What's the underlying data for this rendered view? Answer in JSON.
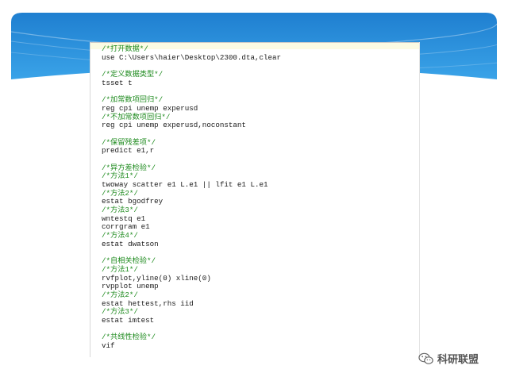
{
  "code_lines": [
    {
      "kind": "comment",
      "text": "/*打开数据*/"
    },
    {
      "kind": "code",
      "text": "use C:\\Users\\haier\\Desktop\\2300.dta,clear"
    },
    {
      "kind": "blank",
      "text": ""
    },
    {
      "kind": "comment",
      "text": "/*定义数据类型*/"
    },
    {
      "kind": "code",
      "text": "tsset t"
    },
    {
      "kind": "blank",
      "text": ""
    },
    {
      "kind": "comment",
      "text": "/*加常数项回归*/"
    },
    {
      "kind": "code",
      "text": "reg cpi unemp experusd"
    },
    {
      "kind": "comment",
      "text": "/*不加常数项回归*/"
    },
    {
      "kind": "code",
      "text": "reg cpi unemp experusd,noconstant"
    },
    {
      "kind": "blank",
      "text": ""
    },
    {
      "kind": "comment",
      "text": "/*保留残差项*/"
    },
    {
      "kind": "code",
      "text": "predict e1,r"
    },
    {
      "kind": "blank",
      "text": ""
    },
    {
      "kind": "comment",
      "text": "/*异方差检验*/"
    },
    {
      "kind": "comment",
      "text": "/*方法1*/"
    },
    {
      "kind": "code",
      "text": "twoway scatter e1 L.e1 || lfit e1 L.e1"
    },
    {
      "kind": "comment",
      "text": "/*方法2*/"
    },
    {
      "kind": "code",
      "text": "estat bgodfrey"
    },
    {
      "kind": "comment",
      "text": "/*方法3*/"
    },
    {
      "kind": "code",
      "text": "wntestq e1"
    },
    {
      "kind": "code",
      "text": "corrgram e1"
    },
    {
      "kind": "comment",
      "text": "/*方法4*/"
    },
    {
      "kind": "code",
      "text": "estat dwatson"
    },
    {
      "kind": "blank",
      "text": ""
    },
    {
      "kind": "comment",
      "text": "/*自相关检验*/"
    },
    {
      "kind": "comment",
      "text": "/*方法1*/"
    },
    {
      "kind": "code",
      "text": "rvfplot,yline(0) xline(0)"
    },
    {
      "kind": "code",
      "text": "rvpplot unemp"
    },
    {
      "kind": "comment",
      "text": "/*方法2*/"
    },
    {
      "kind": "code",
      "text": "estat hettest,rhs iid"
    },
    {
      "kind": "comment",
      "text": "/*方法3*/"
    },
    {
      "kind": "code",
      "text": "estat imtest"
    },
    {
      "kind": "blank",
      "text": ""
    },
    {
      "kind": "comment",
      "text": "/*共线性检验*/"
    },
    {
      "kind": "code",
      "text": "vif"
    }
  ],
  "watermark": {
    "text": "科研联盟",
    "icon": "wechat-icon"
  },
  "colors": {
    "comment": "#1d8a1d",
    "code": "#1a1a1a",
    "header_blue": "#2f8fd8",
    "editor_highlight": "#fbfbe3"
  }
}
